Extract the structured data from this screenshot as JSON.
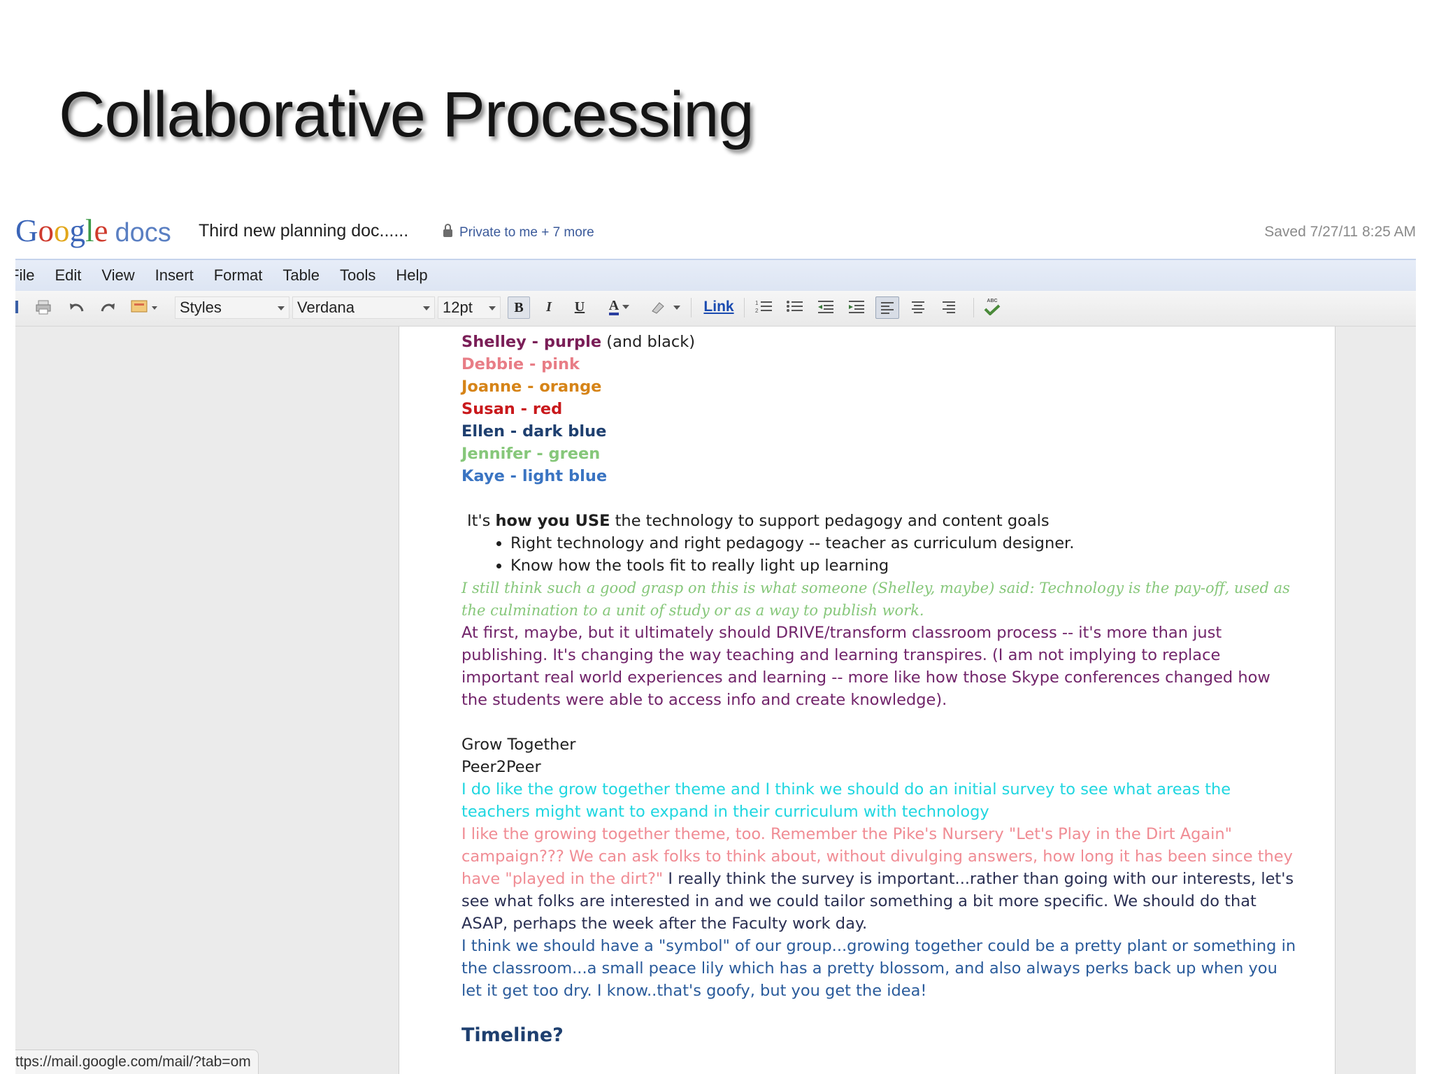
{
  "slide": {
    "title": "Collaborative Processing"
  },
  "header": {
    "logo": {
      "g1": "G",
      "g2": "o",
      "g3": "o",
      "g4": "g",
      "g5": "l",
      "g6": "e",
      "docs": "docs"
    },
    "doc_title": "Third new planning doc......",
    "sharing": "Private to me + 7 more",
    "saved": "Saved 7/27/11 8:25 AM"
  },
  "menu": [
    "File",
    "Edit",
    "View",
    "Insert",
    "Format",
    "Table",
    "Tools",
    "Help"
  ],
  "toolbar": {
    "styles": "Styles",
    "font": "Verdana",
    "size": "12pt",
    "bold": "B",
    "italic": "I",
    "underline": "U",
    "text_color": "A",
    "link": "Link",
    "spellcheck": "ABC"
  },
  "document": {
    "legend": [
      {
        "name": "Shelley - purple",
        "suffix": " (and black)",
        "color": "#7a1e57"
      },
      {
        "name": "Debbie - pink",
        "color": "#e87d86"
      },
      {
        "name": "Joanne - orange",
        "color": "#d68418"
      },
      {
        "name": "Susan - red",
        "color": "#c9191c"
      },
      {
        "name": "Ellen - dark blue",
        "color": "#1e3f6f"
      },
      {
        "name": "Jennifer - green",
        "color": "#86c77a"
      },
      {
        "name": "Kaye - light blue",
        "color": "#3a74c2"
      }
    ],
    "intro_pre": "It's ",
    "intro_bold": "how you USE",
    "intro_post": " the technology to support pedagogy and content goals",
    "bullets": [
      "Right technology and right pedagogy -- teacher as curriculum designer.",
      "Know how the tools fit to really light up learning"
    ],
    "green_comment": "I still think such a good grasp on this is what someone (Shelley, maybe) said:  Technology is the pay-off, used as the culmination to a unit of study or as a way to publish work.",
    "purple_para": "At first, maybe, but it ultimately should DRIVE/transform classroom process -- it's more than just publishing. It's changing the way teaching and learning transpires. (I am not implying to replace important real world experiences and learning -- more like how those Skype conferences changed how the students were able to access info and create knowledge).",
    "grow_together": "Grow Together",
    "peer2peer": "Peer2Peer",
    "cyan_para": "I do like the grow together theme and I think we should do an initial survey to see what areas the teachers might want to expand in their curriculum with technology",
    "pink_para": "I like the growing together theme, too.  Remember the Pike's Nursery \"Let's Play in the Dirt Again\" campaign???  We can ask folks to think about, without divulging answers, how long it has been since they have \"played in the dirt?\"",
    "dark_para": " I really think the survey is important...rather than going with our interests, let's see what folks are interested in and we could tailor something a bit more specific.  We should do that ASAP, perhaps the week after the Faculty work day.",
    "blue_para": " I think we should have a \"symbol\" of our group...growing together could be a pretty plant or something in the classroom...a small peace lily which has a pretty blossom, and also always perks back up when you let it get too dry.  I know..that's goofy, but you get the idea!",
    "timeline": "Timeline?"
  },
  "status_url": "ttps://mail.google.com/mail/?tab=om"
}
